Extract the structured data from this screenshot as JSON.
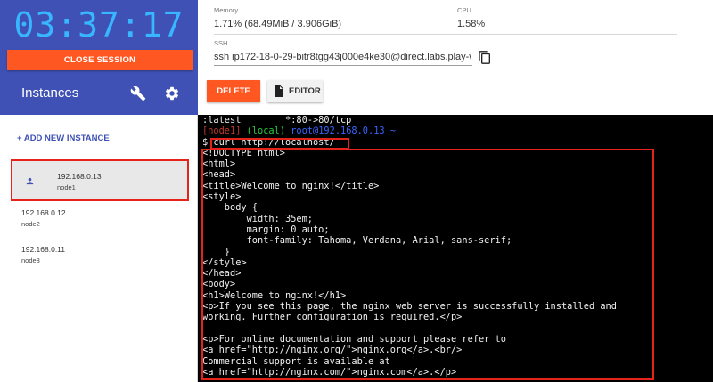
{
  "session": {
    "timer": "03:37:17",
    "close_label": "CLOSE SESSION"
  },
  "sidebar": {
    "title": "Instances",
    "add_instance_label": "+ ADD NEW INSTANCE",
    "instances": [
      {
        "ip": "192.168.0.13",
        "name": "node1",
        "selected": true
      },
      {
        "ip": "192.168.0.12",
        "name": "node2",
        "selected": false
      },
      {
        "ip": "192.168.0.11",
        "name": "node3",
        "selected": false
      }
    ]
  },
  "info": {
    "memory_label": "Memory",
    "memory_value": "1.71% (68.49MiB / 3.906GiB)",
    "cpu_label": "CPU",
    "cpu_value": "1.58%",
    "ssh_label": "SSH",
    "ssh_value": "ssh ip172-18-0-29-bitr8tgg43j000e4ke30@direct.labs.play-w",
    "delete_label": "DELETE",
    "editor_label": "EDITOR"
  },
  "terminal": {
    "line0": ":latest        *:80->80/tcp",
    "prompt_node": "[node1]",
    "prompt_local": "(local)",
    "prompt_user": "root@192.168.0.13",
    "prompt_tilde": "~",
    "command": "$ curl http://localhost/",
    "output": [
      "<!DOCTYPE html>",
      "<html>",
      "<head>",
      "<title>Welcome to nginx!</title>",
      "<style>",
      "    body {",
      "        width: 35em;",
      "        margin: 0 auto;",
      "        font-family: Tahoma, Verdana, Arial, sans-serif;",
      "    }",
      "</style>",
      "</head>",
      "<body>",
      "<h1>Welcome to nginx!</h1>",
      "<p>If you see this page, the nginx web server is successfully installed and",
      "working. Further configuration is required.</p>",
      "",
      "<p>For online documentation and support please refer to",
      "<a href=\"http://nginx.org/\">nginx.org</a>.<br/>",
      "Commercial support is available at",
      "<a href=\"http://nginx.com/\">nginx.com</a>.</p>"
    ]
  },
  "colors": {
    "sidebar_header": "#3f51b5",
    "timer": "#38b6ff",
    "accent_orange": "#ff5722",
    "highlight_red": "#e5231b",
    "terminal_bg": "#000000"
  },
  "icons": [
    "wrench-icon",
    "gear-icon",
    "person-icon",
    "copy-icon",
    "file-icon"
  ]
}
